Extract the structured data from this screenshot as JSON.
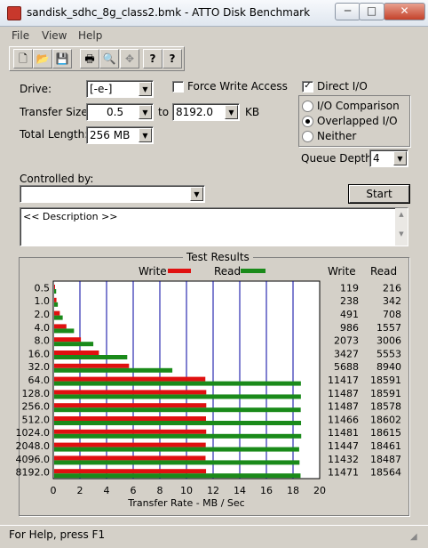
{
  "window": {
    "title": "sandisk_sdhc_8g_class2.bmk - ATTO Disk Benchmark",
    "minimize": "─",
    "maximize": "□",
    "close": "✕"
  },
  "menu": [
    "File",
    "View",
    "Help"
  ],
  "toolbar": {
    "icons": [
      "new-icon",
      "open-icon",
      "save-icon",
      "print-icon",
      "print-preview-icon",
      "move-icon",
      "help-icon",
      "context-help-icon"
    ],
    "glyphs": [
      "🗋",
      "📂",
      "💾",
      "🖶",
      "🔍",
      "✥",
      "?",
      "?"
    ]
  },
  "form": {
    "drive_label": "Drive:",
    "drive_value": "[-e-]",
    "force_write_label": "Force Write Access",
    "force_write_checked": false,
    "direct_io_label": "Direct I/O",
    "direct_io_checked": true,
    "direct_io_mark": "✓",
    "transfer_size_label": "Transfer Size:",
    "transfer_from": "0.5",
    "to_label": "to",
    "transfer_to": "8192.0",
    "kb_label": "KB",
    "total_length_label": "Total Length:",
    "total_length_value": "256 MB",
    "io_options": [
      "I/O Comparison",
      "Overlapped I/O",
      "Neither"
    ],
    "io_selected": 1,
    "queue_depth_label": "Queue Depth:",
    "queue_depth_value": "4",
    "controlled_by_label": "Controlled by:",
    "controlled_by_value": "",
    "start_label": "Start",
    "description": "<< Description >>"
  },
  "results": {
    "title": "Test Results",
    "legend_write": "Write",
    "legend_read": "Read",
    "col_write": "Write",
    "col_read": "Read",
    "write_color": "#e01010",
    "read_color": "#1a8a1a",
    "grid_color": "#0000a0"
  },
  "chart_data": {
    "type": "bar",
    "orientation": "horizontal",
    "categories": [
      "0.5",
      "1.0",
      "2.0",
      "4.0",
      "8.0",
      "16.0",
      "32.0",
      "64.0",
      "128.0",
      "256.0",
      "512.0",
      "1024.0",
      "2048.0",
      "4096.0",
      "8192.0"
    ],
    "series": [
      {
        "name": "Write",
        "values": [
          0.119,
          0.238,
          0.491,
          0.986,
          2.073,
          3.427,
          5.688,
          11.417,
          11.487,
          11.487,
          11.466,
          11.481,
          11.447,
          11.432,
          11.471
        ]
      },
      {
        "name": "Read",
        "values": [
          0.216,
          0.342,
          0.708,
          1.557,
          3.006,
          5.553,
          8.94,
          18.591,
          18.591,
          18.578,
          18.602,
          18.615,
          18.461,
          18.487,
          18.564
        ]
      }
    ],
    "write_kb": [
      119,
      238,
      491,
      986,
      2073,
      3427,
      5688,
      11417,
      11487,
      11487,
      11466,
      11481,
      11447,
      11432,
      11471
    ],
    "read_kb": [
      216,
      342,
      708,
      1557,
      3006,
      5553,
      8940,
      18591,
      18591,
      18578,
      18602,
      18615,
      18461,
      18487,
      18564
    ],
    "xticks": [
      "0",
      "2",
      "4",
      "6",
      "8",
      "10",
      "12",
      "14",
      "16",
      "18",
      "20"
    ],
    "xlabel": "Transfer Rate - MB / Sec",
    "xlim": [
      0,
      20
    ]
  },
  "status": {
    "text": "For Help, press F1"
  }
}
